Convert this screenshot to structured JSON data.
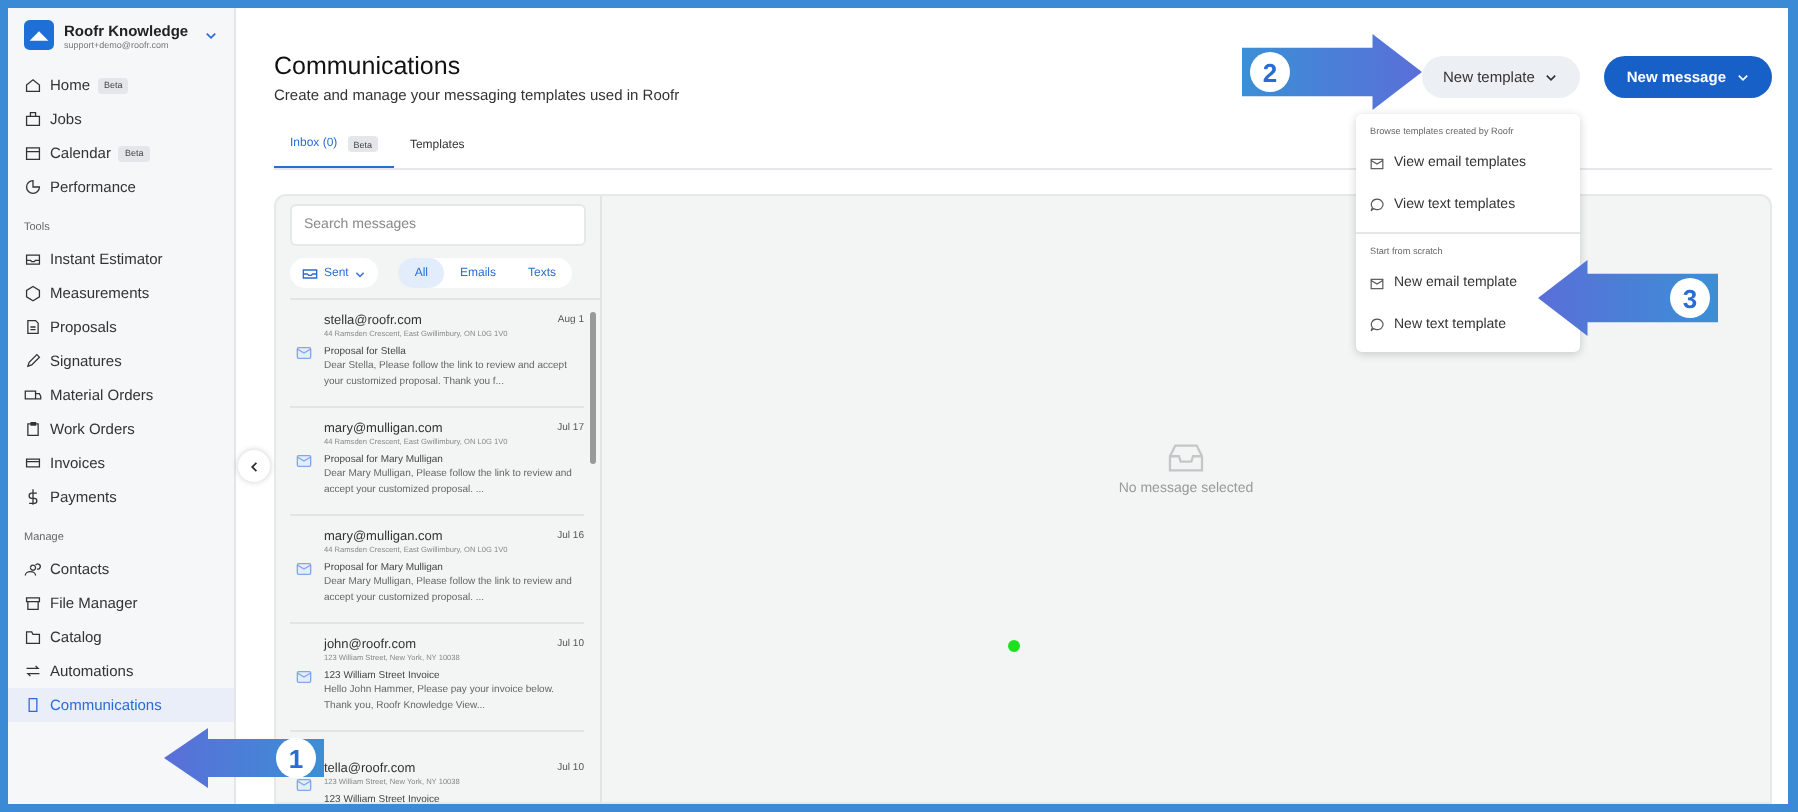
{
  "sidebar": {
    "account": {
      "name": "Roofr Knowledge",
      "email": "support+demo@roofr.com"
    },
    "sections": [
      {
        "items": [
          {
            "label": "Home",
            "badge": "Beta",
            "selected": false
          },
          {
            "label": "Jobs",
            "selected": false
          },
          {
            "label": "Calendar",
            "badge": "Beta",
            "selected": false
          },
          {
            "label": "Performance",
            "selected": false
          }
        ]
      },
      {
        "label": "Tools",
        "items": [
          {
            "label": "Instant Estimator",
            "selected": false
          },
          {
            "label": "Measurements",
            "selected": false
          },
          {
            "label": "Proposals",
            "selected": false
          },
          {
            "label": "Signatures",
            "selected": false
          },
          {
            "label": "Material Orders",
            "selected": false
          },
          {
            "label": "Work Orders",
            "selected": false
          },
          {
            "label": "Invoices",
            "selected": false
          },
          {
            "label": "Payments",
            "selected": false
          }
        ]
      },
      {
        "label": "Manage",
        "items": [
          {
            "label": "Contacts",
            "selected": false
          },
          {
            "label": "File Manager",
            "selected": false
          },
          {
            "label": "Catalog",
            "selected": false
          },
          {
            "label": "Automations",
            "selected": false
          },
          {
            "label": "Communications",
            "selected": true
          }
        ]
      }
    ]
  },
  "header": {
    "title": "Communications",
    "subtitle": "Create and manage your messaging templates used in Roofr"
  },
  "actions": [
    {
      "label": "New template",
      "kind": "secondary"
    },
    {
      "label": "New message",
      "kind": "primary"
    }
  ],
  "template_menu": {
    "sections": [
      {
        "heading": "Browse templates created by Roofr",
        "items": [
          {
            "label": "View email templates",
            "kind": "email"
          },
          {
            "label": "View text templates",
            "kind": "text"
          }
        ]
      },
      {
        "heading": "Start from scratch",
        "items": [
          {
            "label": "New email template",
            "kind": "email"
          },
          {
            "label": "New text template",
            "kind": "text"
          }
        ]
      }
    ]
  },
  "tabs": [
    {
      "label": "Inbox (0)",
      "badge": "Beta",
      "selected": true
    },
    {
      "label": "Templates",
      "selected": false
    }
  ],
  "inbox": {
    "search": {
      "placeholder": "Search messages"
    },
    "folder": "Sent",
    "filters": [
      {
        "label": "All",
        "selected": true
      },
      {
        "label": "Emails",
        "selected": false
      },
      {
        "label": "Texts",
        "selected": false
      }
    ],
    "messages": [
      {
        "from": "stella@roofr.com",
        "date": "Aug 1",
        "address": "44 Ramsden Crescent, East Gwillimbury, ON L0G 1V0",
        "subject": "Proposal for Stella",
        "preview": "Dear Stella, Please follow the link to review and accept your customized proposal.  Thank you f..."
      },
      {
        "from": "mary@mulligan.com",
        "date": "Jul 17",
        "address": "44 Ramsden Crescent, East Gwillimbury, ON L0G 1V0",
        "subject": "Proposal for Mary Mulligan",
        "preview": "Dear Mary Mulligan, Please follow the link to review and accept your customized proposal. ..."
      },
      {
        "from": "mary@mulligan.com",
        "date": "Jul 16",
        "address": "44 Ramsden Crescent, East Gwillimbury, ON L0G 1V0",
        "subject": "Proposal for Mary Mulligan",
        "preview": "Dear Mary Mulligan, Please follow the link to review and accept your customized proposal. ..."
      },
      {
        "from": "john@roofr.com",
        "date": "Jul 10",
        "address": "123 William Street, New York, NY 10038",
        "subject": "123 William Street Invoice",
        "preview": "Hello John Hammer,  Please pay your invoice below. Thank you,  Roofr Knowledge  View..."
      },
      {
        "from": "tella@roofr.com",
        "date": "Jul 10",
        "address": "123 William Street, New York, NY 10038",
        "subject": "123 William Street Invoice"
      }
    ],
    "empty_state": "No message selected"
  },
  "callouts": [
    {
      "label": "1"
    },
    {
      "label": "2"
    },
    {
      "label": "3"
    }
  ]
}
